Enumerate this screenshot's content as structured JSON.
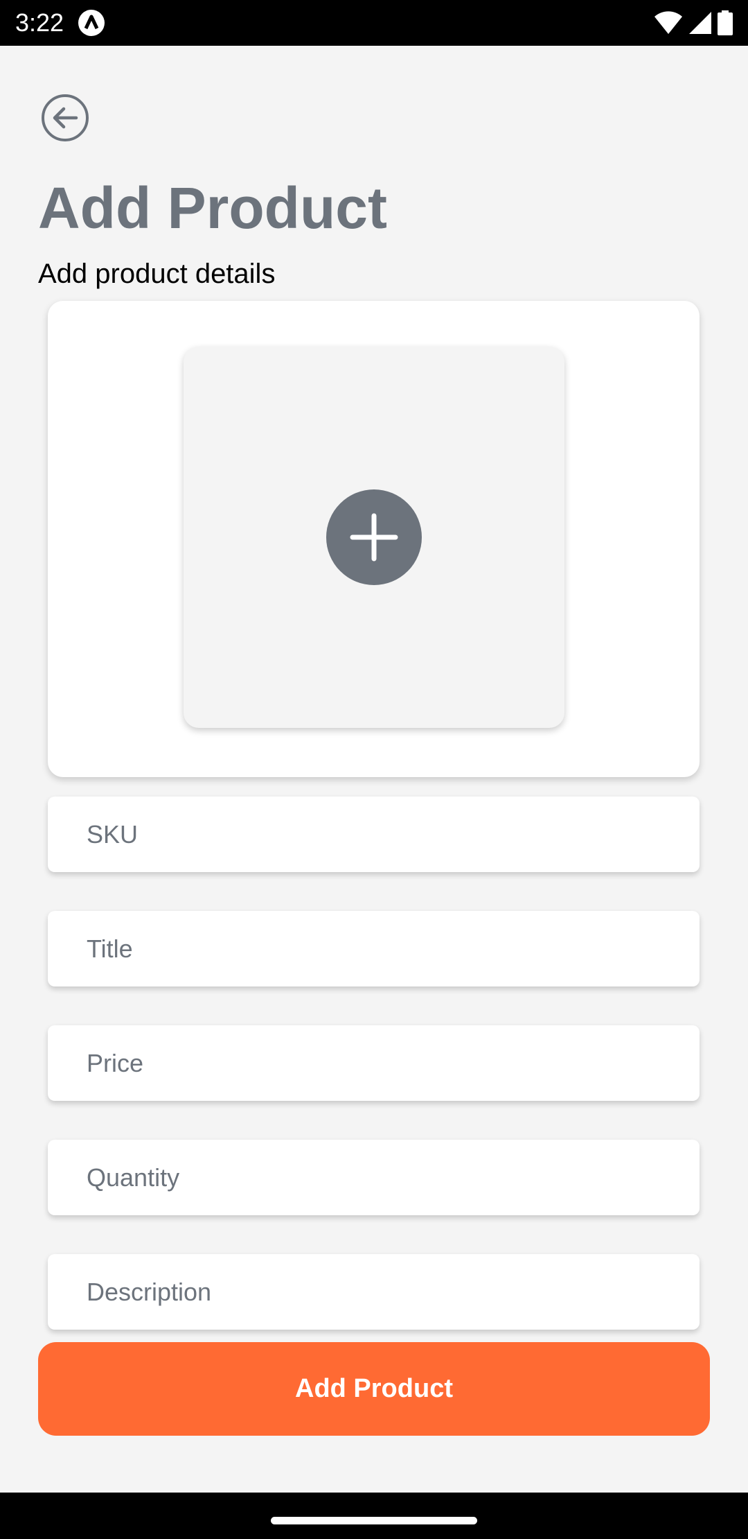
{
  "status_bar": {
    "time": "3:22",
    "icons": [
      "app-notification-icon",
      "wifi-icon",
      "cell-signal-icon",
      "battery-icon"
    ]
  },
  "header": {
    "back_icon": "back-arrow-icon",
    "title": "Add Product",
    "subtitle": "Add product details"
  },
  "image_picker": {
    "icon": "plus-icon"
  },
  "form": {
    "fields": [
      {
        "name": "sku",
        "placeholder": "SKU",
        "value": ""
      },
      {
        "name": "title",
        "placeholder": "Title",
        "value": ""
      },
      {
        "name": "price",
        "placeholder": "Price",
        "value": ""
      },
      {
        "name": "quantity",
        "placeholder": "Quantity",
        "value": ""
      },
      {
        "name": "description",
        "placeholder": "Description",
        "value": ""
      }
    ],
    "submit_label": "Add Product"
  },
  "colors": {
    "accent": "#ff6a33",
    "muted": "#6c737c",
    "background": "#f4f4f4",
    "card": "#ffffff"
  }
}
